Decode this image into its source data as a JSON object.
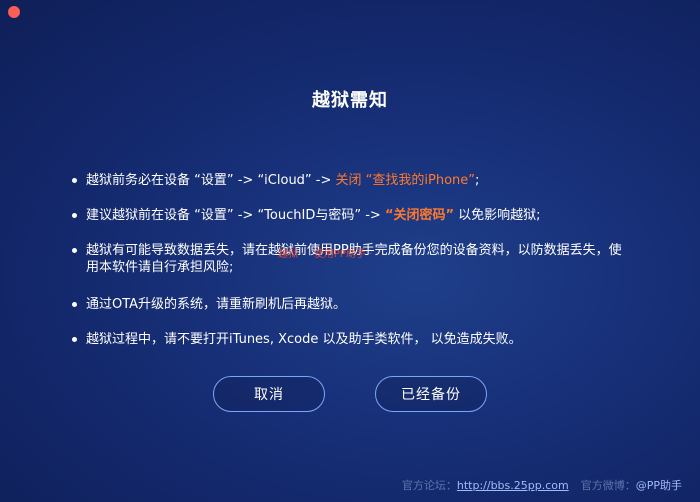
{
  "window": {
    "close_color": "#fc5f57"
  },
  "dialog": {
    "title": "越狱需知"
  },
  "notices": [
    {
      "pre": "越狱前务必在设备 “设置” -> “iCloud” -> ",
      "highlight": "关闭 “查找我的iPhone”",
      "post": ";"
    },
    {
      "pre": "建议越狱前在设备 “设置” -> “TouchID与密码” -> ",
      "highlight": "“关闭密码”",
      "post": " 以免影响越狱;"
    },
    {
      "text": "越狱有可能导致数据丢失，请在越狱前使用PP助手完成备份您的设备资料，以防数据丢失，使用本软件请自行承担风险;"
    },
    {
      "text": "通过OTA升级的系统，请重新刷机后再越狱。"
    },
    {
      "text": "越狱过程中，请不要打开iTunes, Xcode 以及助手类软件， 以免造成失败。"
    }
  ],
  "watermark": "越狱 · · 使用PP助手 · · ·",
  "buttons": {
    "cancel": "取消",
    "backed_up": "已经备份"
  },
  "footer": {
    "forum_label": "官方论坛：",
    "forum_link": "http://bbs.25pp.com",
    "weibo_label": "官方微博：",
    "weibo_handle": "@PP助手"
  },
  "colors": {
    "highlight": "#ff7a2e",
    "button_border": "#7aa6f2",
    "link": "#9fbcf6"
  }
}
